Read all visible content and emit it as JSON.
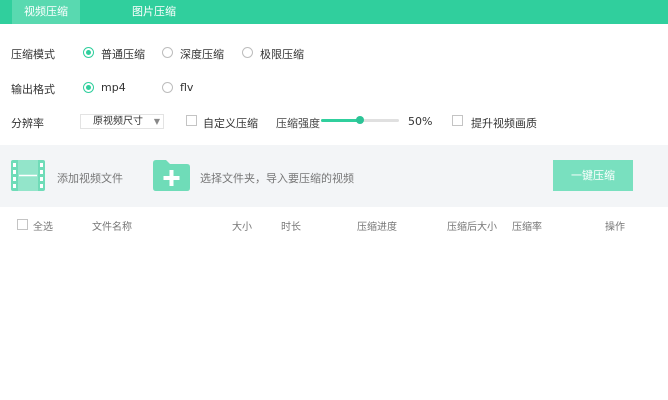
{
  "tabs": [
    {
      "label": "视频压缩",
      "active": true
    },
    {
      "label": "图片压缩",
      "active": false
    }
  ],
  "mode": {
    "label": "压缩模式",
    "options": [
      "普通压缩",
      "深度压缩",
      "极限压缩"
    ],
    "selected": "普通压缩"
  },
  "format": {
    "label": "输出格式",
    "options": [
      "mp4",
      "flv"
    ],
    "selected": "mp4"
  },
  "resolution": {
    "label": "分辨率",
    "select_value": "原视频尺寸",
    "custom_label": "自定义压缩",
    "strength_label": "压缩强度",
    "strength_value": "50%",
    "strength_fraction": 0.5,
    "quality_label": "提升视频画质"
  },
  "dropbar": {
    "add_video": "添加视频文件",
    "add_folder": "选择文件夹，导入要压缩的视频",
    "compress_button": "一键压缩"
  },
  "table": {
    "select_all": "全选",
    "columns": [
      "文件名称",
      "大小",
      "时长",
      "压缩进度",
      "压缩后大小",
      "压缩率",
      "操作"
    ]
  },
  "colors": {
    "accent": "#30cf9d",
    "tab_active": "#59d9b0",
    "button": "#79e0bf",
    "icon": "#6fdcb8"
  }
}
